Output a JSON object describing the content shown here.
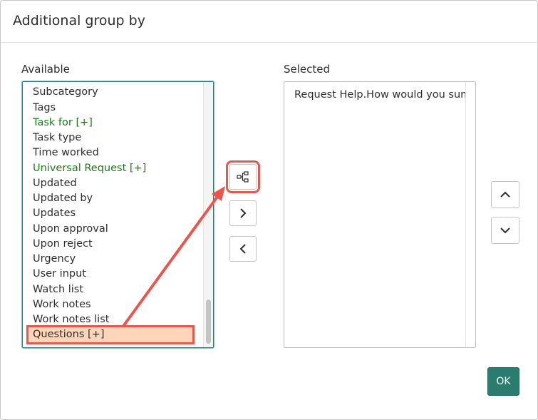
{
  "dialog": {
    "title": "Additional group by"
  },
  "available": {
    "label": "Available",
    "items": [
      {
        "label": "Subcategory",
        "kind": "plain"
      },
      {
        "label": "Tags",
        "kind": "plain"
      },
      {
        "label": "Task for [+]",
        "kind": "ext"
      },
      {
        "label": "Task type",
        "kind": "plain"
      },
      {
        "label": "Time worked",
        "kind": "plain"
      },
      {
        "label": "Universal Request [+]",
        "kind": "ext"
      },
      {
        "label": "Updated",
        "kind": "plain"
      },
      {
        "label": "Updated by",
        "kind": "plain"
      },
      {
        "label": "Updates",
        "kind": "plain"
      },
      {
        "label": "Upon approval",
        "kind": "plain"
      },
      {
        "label": "Upon reject",
        "kind": "plain"
      },
      {
        "label": "Urgency",
        "kind": "plain"
      },
      {
        "label": "User input",
        "kind": "plain"
      },
      {
        "label": "Watch list",
        "kind": "plain"
      },
      {
        "label": "Work notes",
        "kind": "plain"
      },
      {
        "label": "Work notes list",
        "kind": "plain"
      },
      {
        "label": "Questions [+]",
        "kind": "highlight"
      }
    ]
  },
  "selected": {
    "label": "Selected",
    "items": [
      "Request Help.How would you summ"
    ]
  },
  "controls": {
    "dot_walk_icon": "dot-walk-icon",
    "add_icon": "chevron-right-icon",
    "remove_icon": "chevron-left-icon",
    "move_up_icon": "chevron-up-icon",
    "move_down_icon": "chevron-down-icon"
  },
  "footer": {
    "ok_label": "OK"
  },
  "colors": {
    "accent": "#2a7c6f",
    "annotation": "#e8564e",
    "extended_field": "#1d7a1d",
    "highlight_fill": "#fdd5b8"
  }
}
